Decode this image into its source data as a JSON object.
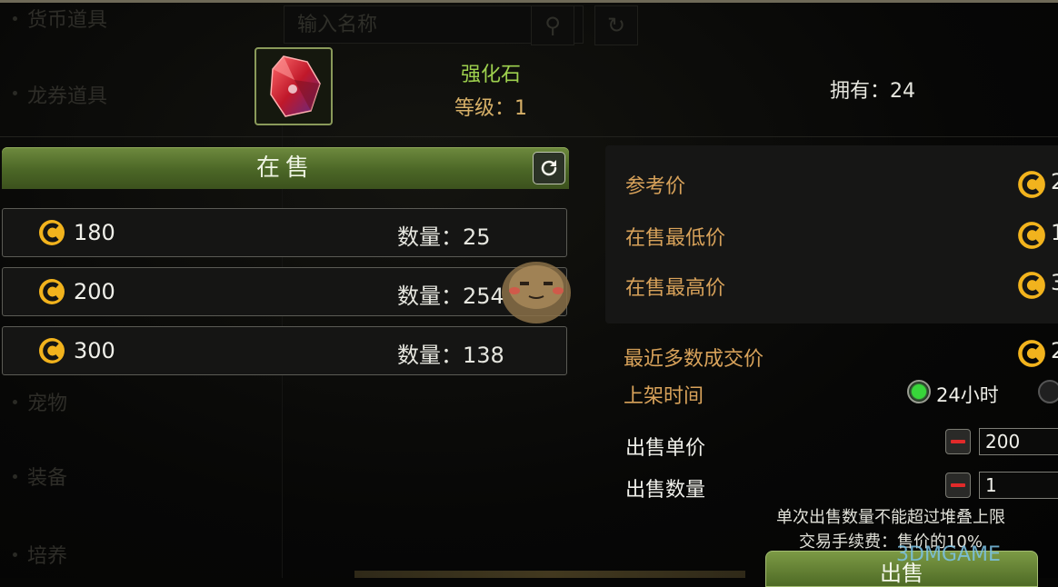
{
  "background_menu": {
    "items": [
      "货币道具",
      "龙券道具",
      "宠物",
      "装备",
      "培养"
    ],
    "search_placeholder": "输入名称"
  },
  "item": {
    "name": "强化石",
    "level_text": "等级：1",
    "owned_text": "拥有：24",
    "icon": "red-gem-icon"
  },
  "on_sale": {
    "title": "在售",
    "refresh_icon": "refresh-icon",
    "listings": [
      {
        "price": "180",
        "qty_text": "数量：25"
      },
      {
        "price": "200",
        "qty_text": "数量：254"
      },
      {
        "price": "300",
        "qty_text": "数量：138"
      }
    ]
  },
  "stats": {
    "reference_price_label": "参考价",
    "reference_price_value": "2",
    "lowest_price_label": "在售最低价",
    "lowest_price_value": "1",
    "highest_price_label": "在售最高价",
    "highest_price_value": "3",
    "recent_price_label": "最近多数成交价",
    "recent_price_value": "2"
  },
  "form": {
    "listing_time_label": "上架时间",
    "listing_time_option": "24小时",
    "unit_price_label": "出售单价",
    "unit_price_value": "200",
    "quantity_label": "出售数量",
    "quantity_value": "1",
    "notice_line1": "单次出售数量不能超过堆叠上限",
    "notice_line2": "交易手续费：售价的10%",
    "sell_button": "出售"
  },
  "watermark": "3DMGAME",
  "colors": {
    "accent_green": "#9ed14e",
    "label_gold": "#d8a25a",
    "coin_gold": "#f2b31d",
    "header_green": "#4b6626"
  }
}
